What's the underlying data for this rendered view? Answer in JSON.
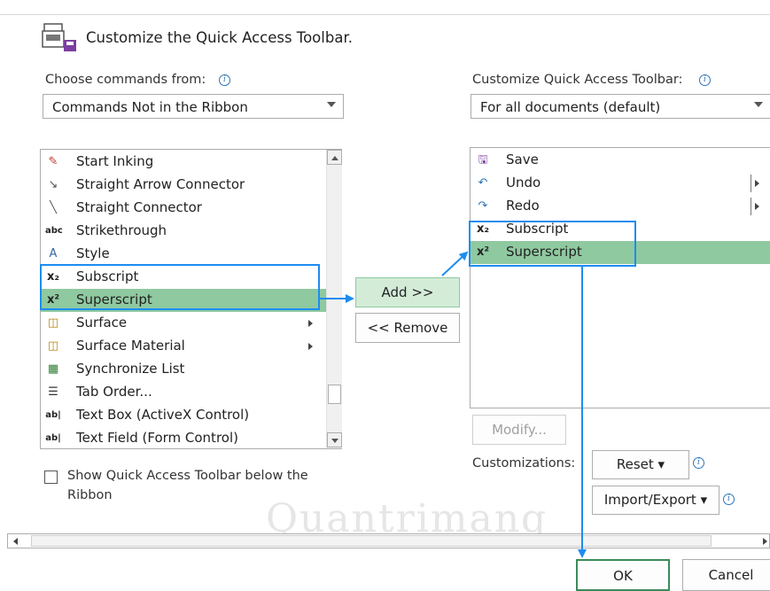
{
  "header": {
    "title": "Customize the Quick Access Toolbar."
  },
  "left": {
    "choose_label": "Choose commands from:",
    "choose_value": "Commands Not in the Ribbon",
    "commands": [
      {
        "icon": "start-inking-icon",
        "label": "Start Inking",
        "glyph": "✎",
        "color": "#c0392b"
      },
      {
        "icon": "straight-arrow-connector-icon",
        "label": "Straight Arrow Connector",
        "glyph": "↘",
        "color": "#555555"
      },
      {
        "icon": "straight-connector-icon",
        "label": "Straight Connector",
        "glyph": "╲",
        "color": "#555555"
      },
      {
        "icon": "strikethrough-icon",
        "label": "Strikethrough",
        "glyph": "abc",
        "color": "#222222"
      },
      {
        "icon": "style-icon",
        "label": "Style",
        "glyph": "A",
        "color": "#3366aa"
      },
      {
        "icon": "subscript-icon",
        "label": "Subscript",
        "glyph": "x₂",
        "color": "#222222"
      },
      {
        "icon": "superscript-icon",
        "label": "Superscript",
        "glyph": "x²",
        "color": "#222222",
        "selected": true
      },
      {
        "icon": "surface-icon",
        "label": "Surface",
        "glyph": "◫",
        "color": "#b8860b",
        "submenu": true
      },
      {
        "icon": "surface-material-icon",
        "label": "Surface Material",
        "glyph": "◫",
        "color": "#b8860b",
        "submenu": true
      },
      {
        "icon": "synchronize-list-icon",
        "label": "Synchronize List",
        "glyph": "▦",
        "color": "#2e7d32"
      },
      {
        "icon": "tab-order-icon",
        "label": "Tab Order...",
        "glyph": "☰",
        "color": "#333333"
      },
      {
        "icon": "text-box-activex-icon",
        "label": "Text Box (ActiveX Control)",
        "glyph": "ab|",
        "color": "#222222"
      },
      {
        "icon": "text-field-form-icon",
        "label": "Text Field (Form Control)",
        "glyph": "ab|",
        "color": "#222222"
      }
    ],
    "show_below_label_1": "Show Quick Access Toolbar below the",
    "show_below_label_2": "Ribbon"
  },
  "middle": {
    "add_label": "Add >>",
    "remove_label": "<< Remove"
  },
  "right": {
    "customize_label": "Customize Quick Access Toolbar:",
    "customize_value": "For all documents (default)",
    "items": [
      {
        "icon": "save-icon",
        "label": "Save",
        "glyph": "🖫",
        "color": "#7b3fa0"
      },
      {
        "icon": "undo-icon",
        "label": "Undo",
        "glyph": "↶",
        "color": "#2e75b6",
        "split": true
      },
      {
        "icon": "redo-icon",
        "label": "Redo",
        "glyph": "↷",
        "color": "#2e75b6",
        "split": true
      },
      {
        "icon": "subscript-icon",
        "label": "Subscript",
        "glyph": "x₂",
        "color": "#222222"
      },
      {
        "icon": "superscript-icon",
        "label": "Superscript",
        "glyph": "x²",
        "color": "#222222",
        "selected": true
      }
    ],
    "modify_label": "Modify...",
    "customizations_label": "Customizations:",
    "reset_label": "Reset ▾",
    "import_export_label": "Import/Export ▾"
  },
  "footer": {
    "ok_label": "OK",
    "cancel_label": "Cancel"
  },
  "watermark": "Quantrimang",
  "colors": {
    "selection": "#8fc9a0",
    "annotation": "#1e8cf0",
    "ok_border": "#3c8a5a"
  }
}
